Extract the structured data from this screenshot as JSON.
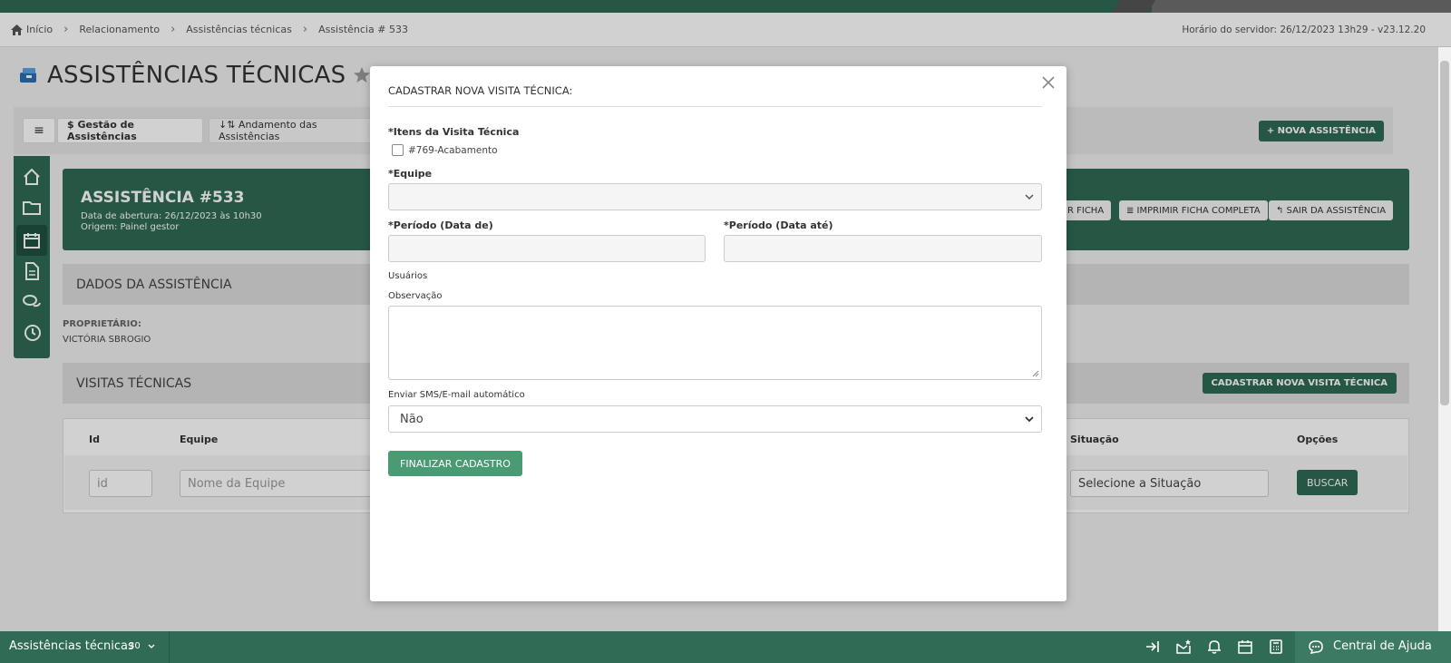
{
  "breadcrumb": [
    "Início",
    "Relacionamento",
    "Assistências técnicas",
    "Assistência # 533"
  ],
  "server_time": "Horário do servidor: 26/12/2023 13h29 - v23.12.20",
  "page": {
    "title": "ASSISTÊNCIAS TÉCNICAS"
  },
  "toolbar": {
    "menu_label": "≡",
    "gestao_label": "$ Gestão de Assistências",
    "andamento_label": "↓⇅ Andamento das Assistências",
    "nova_label": "+ NOVA ASSISTÊNCIA"
  },
  "assistencia": {
    "title": "ASSISTÊNCIA #533",
    "opened": "Data de abertura: 26/12/2023 às 10h30",
    "origin": "Origem: Painel gestor",
    "btn_ficha": "R FICHA",
    "btn_imprimir": "≣ IMPRIMIR FICHA COMPLETA",
    "btn_sair": "↰ SAIR DA ASSISTÊNCIA"
  },
  "dados": {
    "title": "DADOS DA ASSISTÊNCIA",
    "owner_label": "PROPRIETÁRIO:",
    "owner_value": "VICTÓRIA SBROGIO"
  },
  "visitas": {
    "title": "VISITAS TÉCNICAS",
    "cad_button": "CADASTRAR NOVA VISITA TÉCNICA",
    "headers": {
      "id": "Id",
      "equipe": "Equipe",
      "situacao": "Situação",
      "opcoes": "Opções"
    },
    "filters": {
      "id_placeholder": "id",
      "equipe_placeholder": "Nome da Equipe",
      "situacao_placeholder": "Selecione a Situação",
      "buscar": "BUSCAR"
    }
  },
  "modal": {
    "title": "CADASTRAR NOVA VISITA TÉCNICA:",
    "itens_label": "*Itens da Visita Técnica",
    "item_checkbox": "#769-Acabamento",
    "equipe_label": "*Equipe",
    "periodo_de_label": "*Período (Data de)",
    "periodo_ate_label": "*Período (Data até)",
    "usuarios_label": "Usuários",
    "observacao_label": "Observação",
    "sms_label": "Enviar SMS/E-mail automático",
    "sms_value": "Não",
    "submit": "FINALIZAR CADASTRO"
  },
  "bottom_bar": {
    "title": "Assistências técnicas",
    "count": "30",
    "help": "Central de Ajuda"
  },
  "colors": {
    "brand": "#2f6b55",
    "button_green": "#4a9a74"
  }
}
